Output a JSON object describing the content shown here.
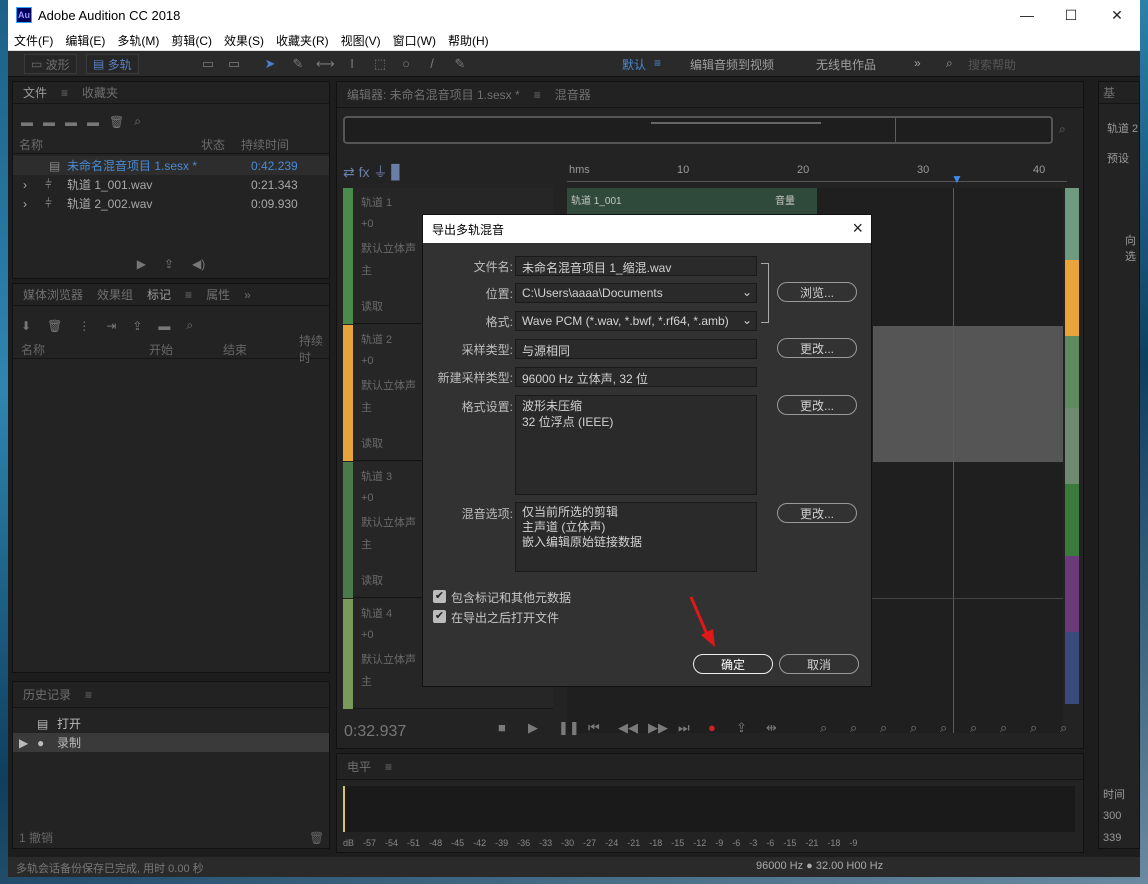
{
  "window": {
    "title": "Adobe Audition CC 2018",
    "logo": "Au"
  },
  "menu": [
    "文件(F)",
    "编辑(E)",
    "多轨(M)",
    "剪辑(C)",
    "效果(S)",
    "收藏夹(R)",
    "视图(V)",
    "窗口(W)",
    "帮助(H)"
  ],
  "toolbar": {
    "waveform": "波形",
    "multitrack": "多轨",
    "workspaces": [
      "默认",
      "编辑音频到视频",
      "无线电作品"
    ],
    "search_placeholder": "搜索帮助"
  },
  "files_panel": {
    "tabs": [
      "文件",
      "收藏夹"
    ],
    "columns": {
      "name": "名称",
      "status": "状态",
      "duration": "持续时间"
    },
    "items": [
      {
        "name": "未命名混音项目 1.sesx *",
        "duration": "0:42.239"
      },
      {
        "name": "轨道 1_001.wav",
        "duration": "0:21.343"
      },
      {
        "name": "轨道 2_002.wav",
        "duration": "0:09.930"
      }
    ]
  },
  "media_panel": {
    "tabs": [
      "媒体浏览器",
      "效果组",
      "标记",
      "属性"
    ],
    "columns": [
      "名称",
      "开始",
      "结束",
      "持续时"
    ]
  },
  "history_panel": {
    "title": "历史记录",
    "items": [
      "打开",
      "录制"
    ],
    "undo_count": "1 撤销"
  },
  "editor": {
    "tab": "编辑器: 未命名混音项目 1.sesx *",
    "mixer_tab": "混音器",
    "ruler": [
      "hms",
      "10",
      "20",
      "30",
      "40"
    ],
    "tracks": [
      {
        "name": "轨道 1",
        "vol": "+0",
        "input": "默认立体声",
        "output": "主",
        "mode": "读取",
        "color": "#4a8a4a"
      },
      {
        "name": "轨道 2",
        "vol": "+0",
        "input": "默认立体声",
        "output": "主",
        "mode": "读取",
        "color": "#e8a33a"
      },
      {
        "name": "轨道 3",
        "vol": "+0",
        "input": "默认立体声",
        "output": "主",
        "mode": "读取",
        "color": "#4a7a4a"
      },
      {
        "name": "轨道 4",
        "vol": "+0",
        "input": "默认立体声",
        "output": "主",
        "mode": "读取",
        "color": "#7a9a5a"
      }
    ],
    "clip_name": "轨道 1_001",
    "clip_label": "音量",
    "time": "0:32.937"
  },
  "levels_panel": {
    "title": "电平",
    "scale": [
      "dB",
      "-57",
      "-54",
      "-51",
      "-48",
      "-45",
      "-42",
      "-39",
      "-36",
      "-33",
      "-30",
      "-27",
      "-24",
      "-21",
      "-18",
      "-15",
      "-12",
      "-9",
      "-6",
      "-3",
      "-6",
      "-15",
      "-21",
      "-18",
      "-9"
    ]
  },
  "right_panel": {
    "tab": "基",
    "items": [
      "轨道 2",
      "预设",
      "向选"
    ],
    "time_label": "时间",
    "t1": "300",
    "t2": "339"
  },
  "status": {
    "left": "多轨会话备份保存已完成, 用时 0.00 秒",
    "right": "96000 Hz ● 32.00 H00 Hz"
  },
  "dialog": {
    "title": "导出多轨混音",
    "filename_label": "文件名:",
    "filename": "未命名混音项目 1_缩混.wav",
    "location_label": "位置:",
    "location": "C:\\Users\\aaaa\\Documents",
    "format_label": "格式:",
    "format": "Wave PCM (*.wav, *.bwf, *.rf64, *.amb)",
    "sample_type_label": "采样类型:",
    "sample_type": "与源相同",
    "new_sample_label": "新建采样类型:",
    "new_sample": "96000 Hz 立体声, 32 位",
    "format_settings_label": "格式设置:",
    "format_settings": [
      "波形未压缩",
      "32 位浮点 (IEEE)"
    ],
    "mix_options_label": "混音选项:",
    "mix_options": [
      "仅当前所选的剪辑",
      "主声道 (立体声)",
      "嵌入编辑原始链接数据"
    ],
    "browse": "浏览...",
    "change": "更改...",
    "checkbox1": "包含标记和其他元数据",
    "checkbox2": "在导出之后打开文件",
    "ok": "确定",
    "cancel": "取消"
  }
}
